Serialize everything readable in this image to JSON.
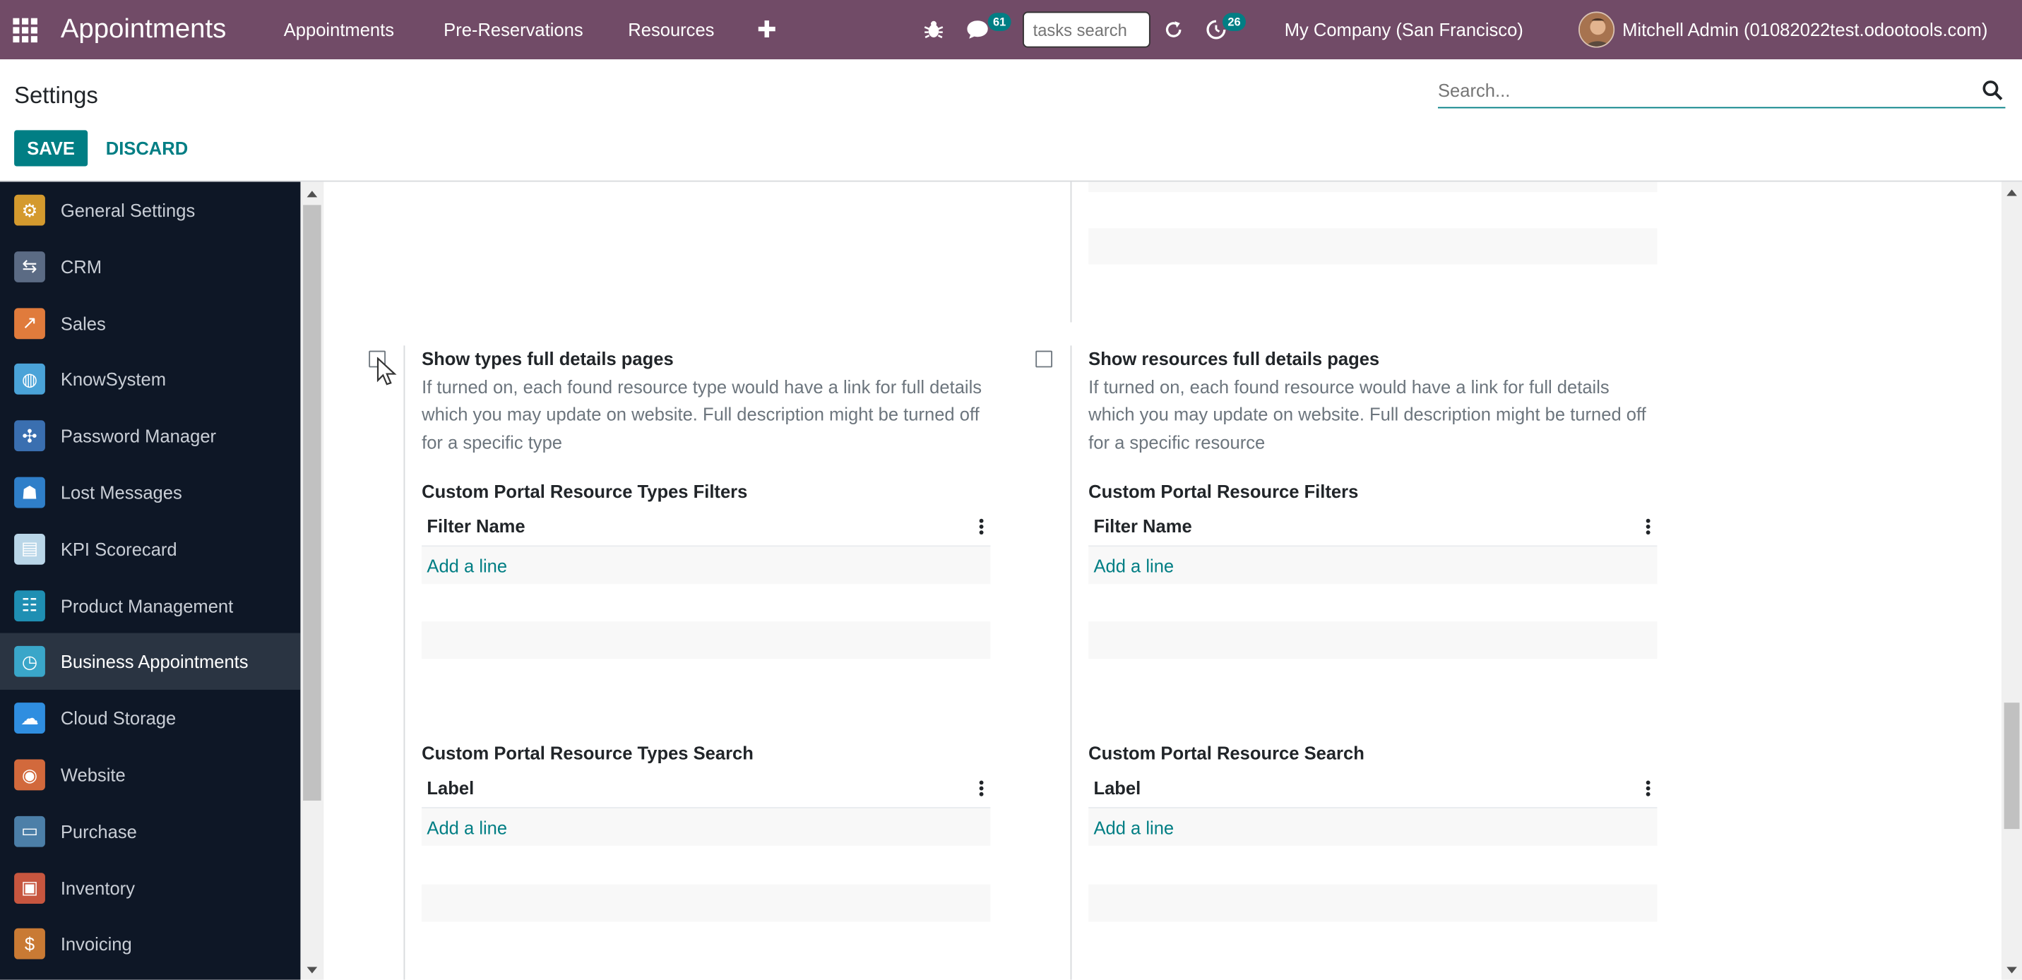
{
  "navbar": {
    "apps_icon": "grid-icon",
    "brand": "Appointments",
    "menu": [
      "Appointments",
      "Pre-Reservations",
      "Resources"
    ],
    "plus": "✚",
    "debug_icon": "bug-icon",
    "messages_count": "61",
    "tasks_search_placeholder": "tasks search",
    "activities_count": "26",
    "company": "My Company (San Francisco)",
    "user": "Mitchell Admin (01082022test.odootools.com)"
  },
  "control_panel": {
    "title": "Settings",
    "search_placeholder": "Search...",
    "save": "SAVE",
    "discard": "DISCARD"
  },
  "sidebar": {
    "items": [
      {
        "label": "General Settings",
        "icon": "gear-icon",
        "color": "#d49a2e"
      },
      {
        "label": "CRM",
        "icon": "handshake-icon",
        "color": "#5b6b84"
      },
      {
        "label": "Sales",
        "icon": "chart-icon",
        "color": "#e07b3c"
      },
      {
        "label": "KnowSystem",
        "icon": "brain-icon",
        "color": "#4aa3d8"
      },
      {
        "label": "Password Manager",
        "icon": "puzzle-icon",
        "color": "#3a6fb0"
      },
      {
        "label": "Lost Messages",
        "icon": "user-question-icon",
        "color": "#2f7fc9"
      },
      {
        "label": "KPI Scorecard",
        "icon": "document-icon",
        "color": "#b9d6e8"
      },
      {
        "label": "Product Management",
        "icon": "hierarchy-icon",
        "color": "#1f8fb3"
      },
      {
        "label": "Business Appointments",
        "icon": "clock-icon",
        "color": "#3aa6c9"
      },
      {
        "label": "Cloud Storage",
        "icon": "cloud-icon",
        "color": "#2f8ee0"
      },
      {
        "label": "Website",
        "icon": "globe-icon",
        "color": "#d2693c"
      },
      {
        "label": "Purchase",
        "icon": "card-icon",
        "color": "#4c7fa8"
      },
      {
        "label": "Inventory",
        "icon": "box-icon",
        "color": "#c7563f"
      },
      {
        "label": "Invoicing",
        "icon": "invoice-icon",
        "color": "#c97a34"
      }
    ],
    "active_index": 8
  },
  "settings": {
    "left": {
      "title": "Show types full details pages",
      "description": "If turned on, each found resource type would have a link for full details which you may update on website. Full description might be turned off for a specific type",
      "filters_title": "Custom Portal Resource Types Filters",
      "filters_column": "Filter Name",
      "filters_add": "Add a line",
      "search_title": "Custom Portal Resource Types Search",
      "search_column": "Label",
      "search_add": "Add a line"
    },
    "right": {
      "title": "Show resources full details pages",
      "description": "If turned on, each found resource would have a link for full details which you may update on website. Full description might be turned off for a specific resource",
      "filters_title": "Custom Portal Resource Filters",
      "filters_column": "Filter Name",
      "filters_add": "Add a line",
      "search_title": "Custom Portal Resource Search",
      "search_column": "Label",
      "search_add": "Add a line"
    }
  },
  "colors": {
    "navbar": "#714B67",
    "accent": "#017e84",
    "sidebar": "#0e1726"
  }
}
